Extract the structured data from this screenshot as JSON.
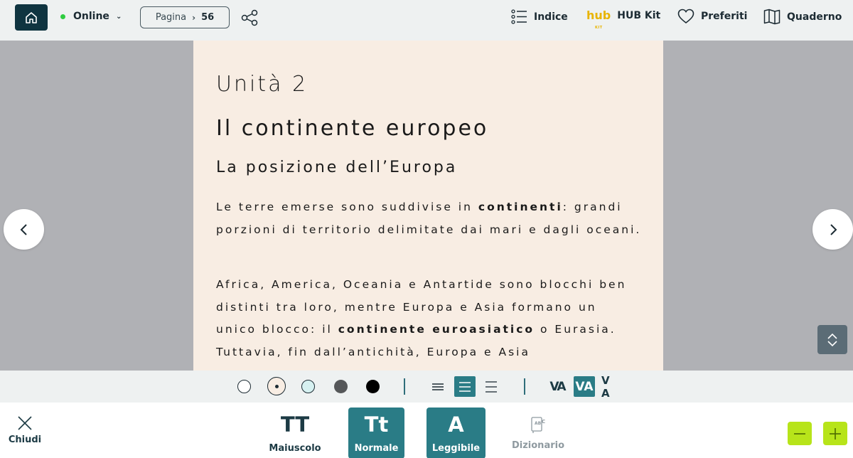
{
  "topbar": {
    "status": "Online",
    "page_label": "Pagina",
    "page_number": "56",
    "nav": {
      "indice": "Indice",
      "hubkit_logo": "hub",
      "hubkit_logo_sub": "KIT",
      "hubkit": "HUB Kit",
      "preferiti": "Preferiti",
      "quaderno": "Quaderno"
    }
  },
  "content": {
    "unit": "Unità 2",
    "title": "Il continente europeo",
    "subtitle": "La posizione dell’Europa",
    "p1": {
      "a": "Le terre emerse sono suddivise in ",
      "b": "continenti",
      "c": ": grandi porzioni di territorio delimitate dai mari e dagli oceani."
    },
    "p2": {
      "a": "Africa, America, Oceania e Antartide sono blocchi ben distinti tra loro, mentre Europa e Asia formano un unico blocco: il ",
      "b": "continente euroasiatico",
      "c": " o Eurasia. Tuttavia, fin dall’antichità, Europa e Asia"
    }
  },
  "settings": {
    "swatch_colors": [
      "#ffffff",
      "#f8ede3",
      "#d6f1f1",
      "#555759",
      "#000000"
    ],
    "spacing_labels": [
      "VA",
      "VA",
      "V A"
    ]
  },
  "bottombar": {
    "close": "Chiudi",
    "modes": [
      {
        "glyph": "TT",
        "label": "Maiuscolo"
      },
      {
        "glyph": "Tt",
        "label": "Normale"
      },
      {
        "glyph": "A",
        "label": "Leggibile"
      },
      {
        "label": "Dizionario"
      }
    ]
  },
  "colors": {
    "accent": "#2a7c86",
    "dark": "#0f3440",
    "zoom": "#b7e41a",
    "online": "#2ecc40",
    "page_bg": "#f8ede3"
  }
}
